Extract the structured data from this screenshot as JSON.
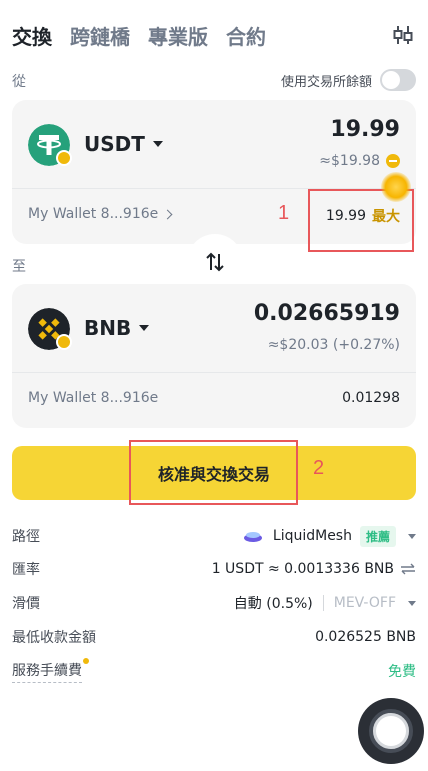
{
  "tabs": [
    {
      "label": "交換"
    },
    {
      "label": "跨鏈橋"
    },
    {
      "label": "專業版"
    },
    {
      "label": "合約"
    }
  ],
  "from": {
    "section_label": "從",
    "balance_toggle_label": "使用交易所餘額",
    "token": "USDT",
    "amount": "19.99",
    "fiat": "≈$19.98",
    "wallet": "My Wallet 8...916e",
    "balance": "19.99",
    "max_label": "最大",
    "icon": "tether-icon"
  },
  "to": {
    "section_label": "至",
    "token": "BNB",
    "amount": "0.02665919",
    "fiat": "≈$20.03 (+0.27%)",
    "wallet": "My Wallet 8...916e",
    "balance": "0.01298",
    "icon": "bnb-icon"
  },
  "annotations": {
    "num1": "1",
    "num2": "2"
  },
  "primary_button": "核准與交換交易",
  "details": {
    "route_label": "路徑",
    "route_value": "LiquidMesh",
    "route_badge": "推薦",
    "rate_label": "匯率",
    "rate_value": "1 USDT ≈ 0.0013336 BNB",
    "slippage_label": "滑價",
    "slippage_value": "自動 (0.5%)",
    "mev_value": "MEV-OFF",
    "min_label": "最低收款金額",
    "min_value": "0.026525 BNB",
    "fee_label": "服務手續費",
    "fee_value": "免費"
  },
  "colors": {
    "primary": "#f6d535",
    "accent_gold": "#c99400",
    "success": "#2ebd85",
    "annotation": "#e8575a"
  }
}
